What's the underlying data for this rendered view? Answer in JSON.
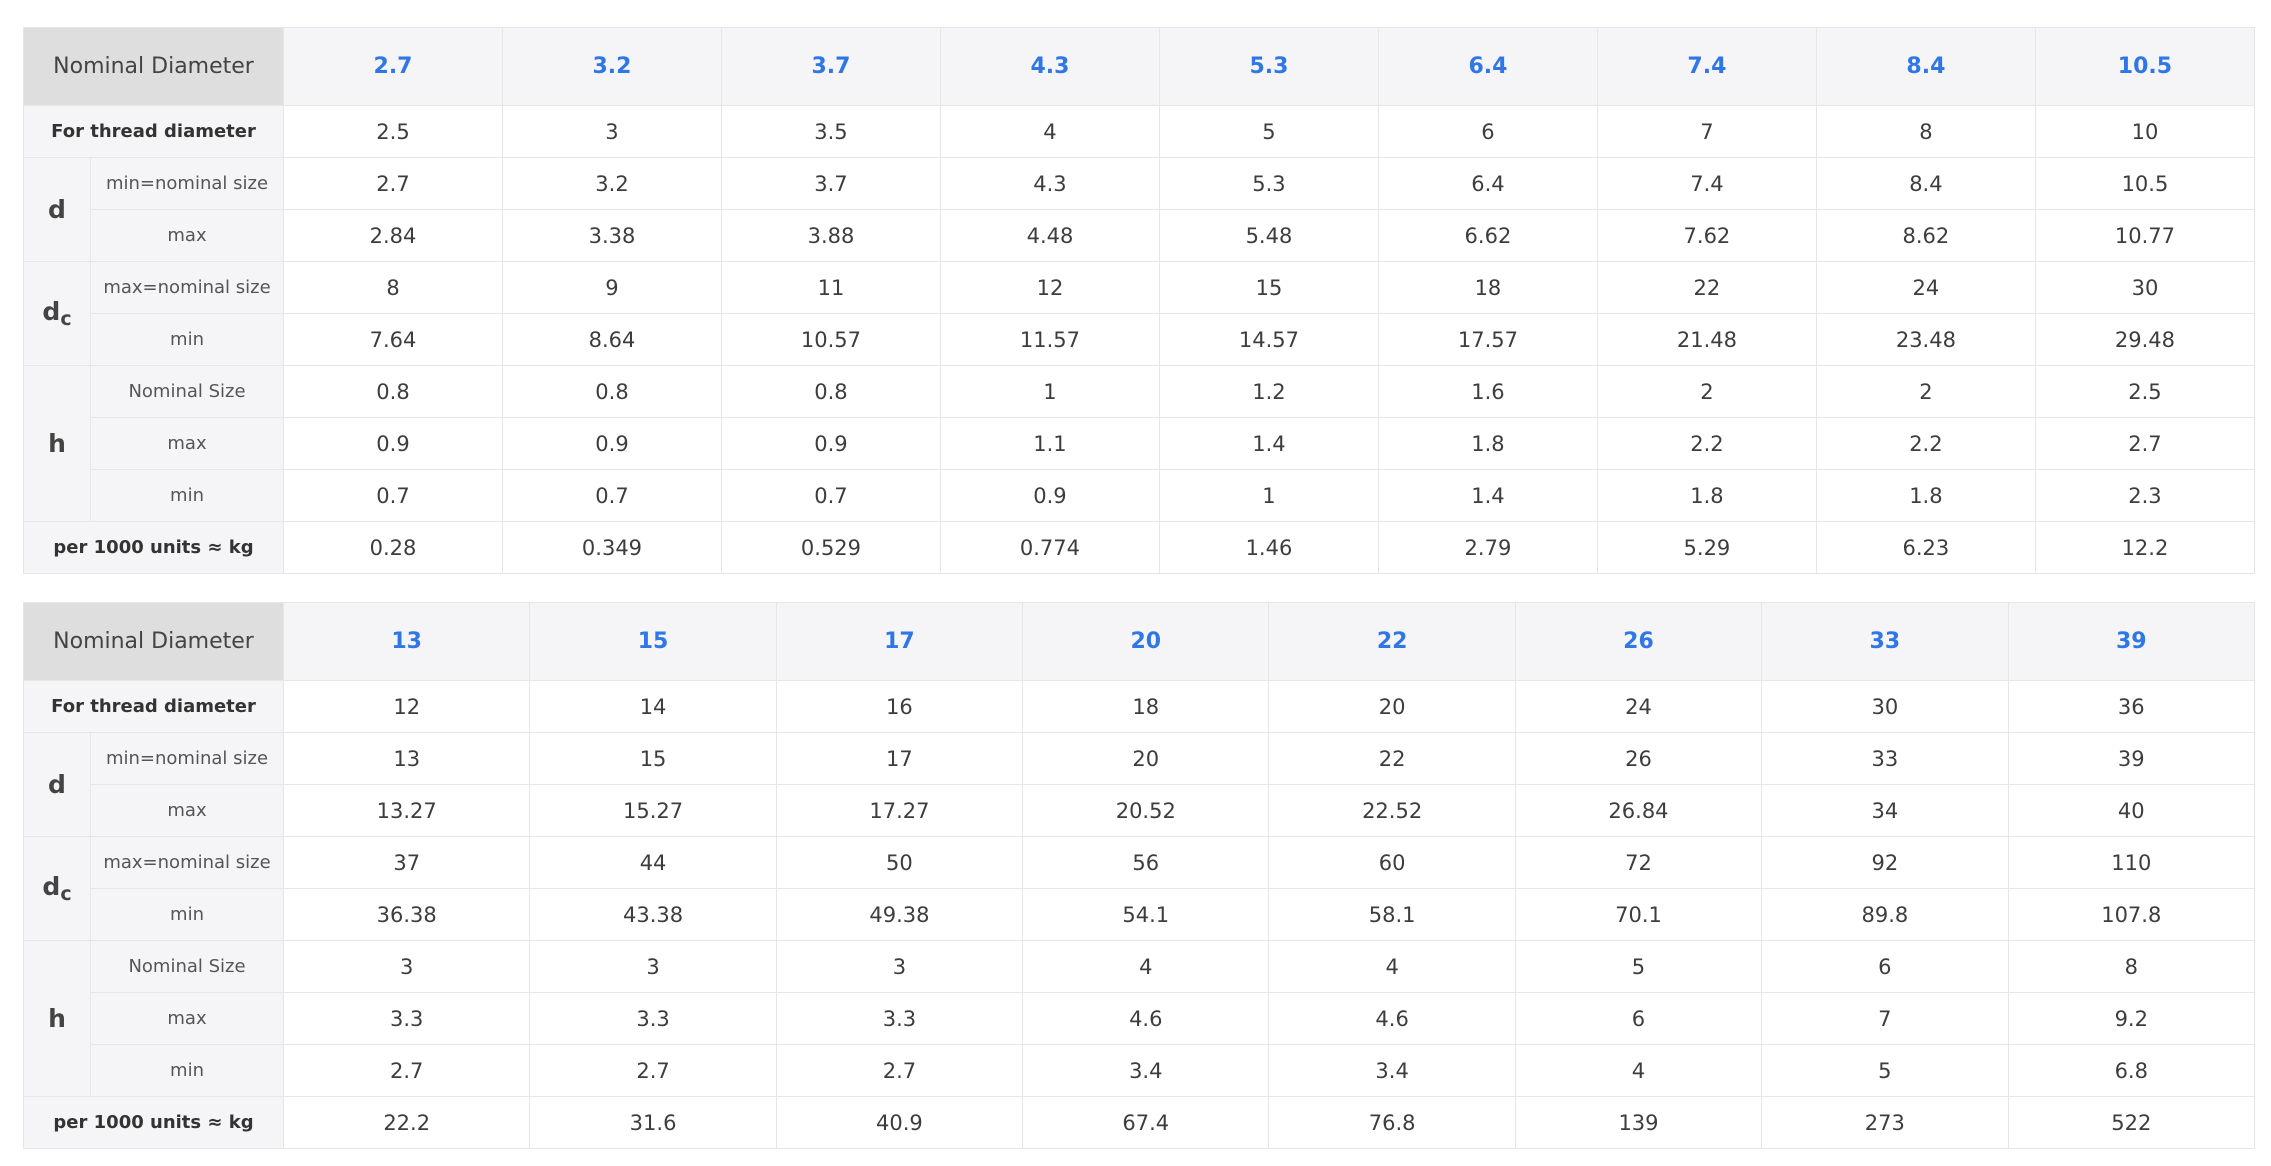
{
  "labels": {
    "nominal_diameter": "Nominal Diameter",
    "for_thread": "For thread diameter",
    "d": "d",
    "dc_main": "d",
    "dc_sub": "c",
    "h": "h",
    "min_nominal": "min=nominal size",
    "max_nominal": "max=nominal size",
    "nominal_size": "Nominal Size",
    "max": "max",
    "min": "min",
    "weight": "per 1000 units ≈ kg"
  },
  "tables": [
    {
      "nominal": [
        "2.7",
        "3.2",
        "3.7",
        "4.3",
        "5.3",
        "6.4",
        "7.4",
        "8.4",
        "10.5"
      ],
      "thread": [
        "2.5",
        "3",
        "3.5",
        "4",
        "5",
        "6",
        "7",
        "8",
        "10"
      ],
      "d_min": [
        "2.7",
        "3.2",
        "3.7",
        "4.3",
        "5.3",
        "6.4",
        "7.4",
        "8.4",
        "10.5"
      ],
      "d_max": [
        "2.84",
        "3.38",
        "3.88",
        "4.48",
        "5.48",
        "6.62",
        "7.62",
        "8.62",
        "10.77"
      ],
      "dc_max": [
        "8",
        "9",
        "11",
        "12",
        "15",
        "18",
        "22",
        "24",
        "30"
      ],
      "dc_min": [
        "7.64",
        "8.64",
        "10.57",
        "11.57",
        "14.57",
        "17.57",
        "21.48",
        "23.48",
        "29.48"
      ],
      "h_nom": [
        "0.8",
        "0.8",
        "0.8",
        "1",
        "1.2",
        "1.6",
        "2",
        "2",
        "2.5"
      ],
      "h_max": [
        "0.9",
        "0.9",
        "0.9",
        "1.1",
        "1.4",
        "1.8",
        "2.2",
        "2.2",
        "2.7"
      ],
      "h_min": [
        "0.7",
        "0.7",
        "0.7",
        "0.9",
        "1",
        "1.4",
        "1.8",
        "1.8",
        "2.3"
      ],
      "weight": [
        "0.28",
        "0.349",
        "0.529",
        "0.774",
        "1.46",
        "2.79",
        "5.29",
        "6.23",
        "12.2"
      ]
    },
    {
      "nominal": [
        "13",
        "15",
        "17",
        "20",
        "22",
        "26",
        "33",
        "39"
      ],
      "thread": [
        "12",
        "14",
        "16",
        "18",
        "20",
        "24",
        "30",
        "36"
      ],
      "d_min": [
        "13",
        "15",
        "17",
        "20",
        "22",
        "26",
        "33",
        "39"
      ],
      "d_max": [
        "13.27",
        "15.27",
        "17.27",
        "20.52",
        "22.52",
        "26.84",
        "34",
        "40"
      ],
      "dc_max": [
        "37",
        "44",
        "50",
        "56",
        "60",
        "72",
        "92",
        "110"
      ],
      "dc_min": [
        "36.38",
        "43.38",
        "49.38",
        "54.1",
        "58.1",
        "70.1",
        "89.8",
        "107.8"
      ],
      "h_nom": [
        "3",
        "3",
        "3",
        "4",
        "4",
        "5",
        "6",
        "8"
      ],
      "h_max": [
        "3.3",
        "3.3",
        "3.3",
        "4.6",
        "4.6",
        "6",
        "7",
        "9.2"
      ],
      "h_min": [
        "2.7",
        "2.7",
        "2.7",
        "3.4",
        "3.4",
        "4",
        "5",
        "6.8"
      ],
      "weight": [
        "22.2",
        "31.6",
        "40.9",
        "67.4",
        "76.8",
        "139",
        "273",
        "522"
      ]
    }
  ],
  "colors": {
    "header_value": "#2f77e6",
    "corner_bg": "#dedede",
    "label_bg": "#f5f5f7",
    "border": "#e6e6e6"
  }
}
